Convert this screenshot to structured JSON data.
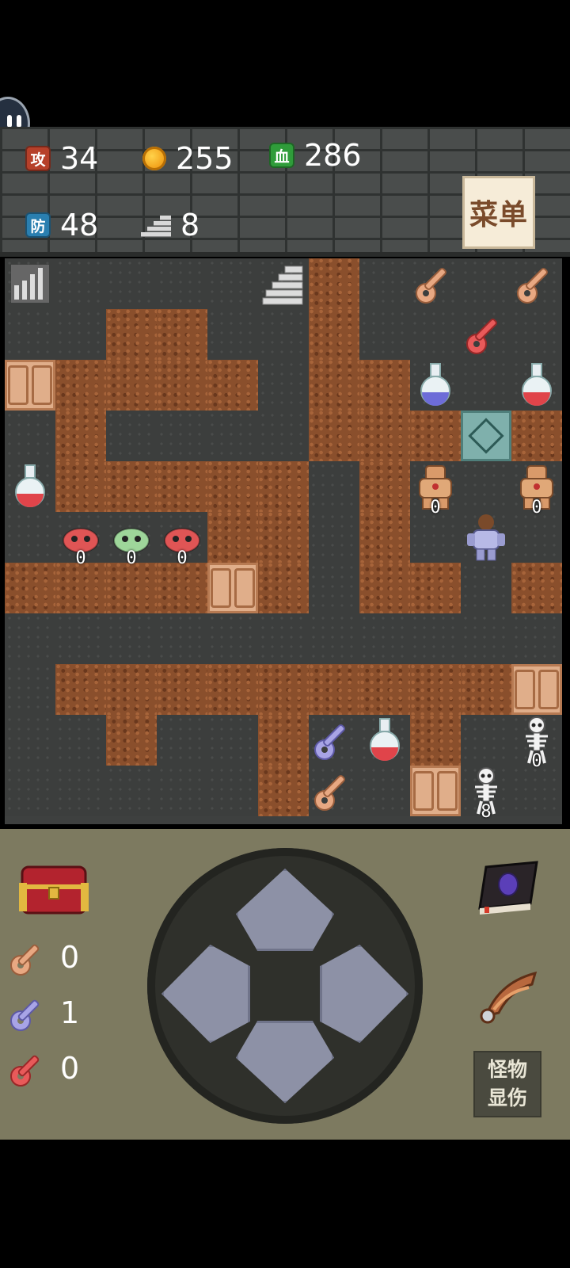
{
  "stats": {
    "attack": {
      "icon_label": "攻",
      "value": "34",
      "color": "#b6402a"
    },
    "gold": {
      "value": "255",
      "color": "#f3a21b"
    },
    "hp": {
      "icon_label": "血",
      "value": "286",
      "color": "#2f9c3a"
    },
    "defense": {
      "icon_label": "防",
      "value": "48",
      "color": "#2a7fb0"
    },
    "floor": {
      "value": "8"
    }
  },
  "menu_label": "菜单",
  "map": {
    "damage_labels": {
      "golem_left": "0",
      "golem_right": "0",
      "slime_red_1": "0",
      "slime_green": "0",
      "slime_red_2": "0",
      "skeleton": "0",
      "skeleton_soldier": "8"
    }
  },
  "inventory": {
    "yellow_keys": "0",
    "blue_keys": "1",
    "red_keys": "0"
  },
  "monster_damage_button": {
    "line1": "怪物",
    "line2": "显伤"
  },
  "colors": {
    "yellow_key": "#e8a882",
    "blue_key": "#a8a4e6",
    "red_key": "#e85a5a",
    "wall": "#8a4f2c",
    "panel": "#7d7a60"
  }
}
